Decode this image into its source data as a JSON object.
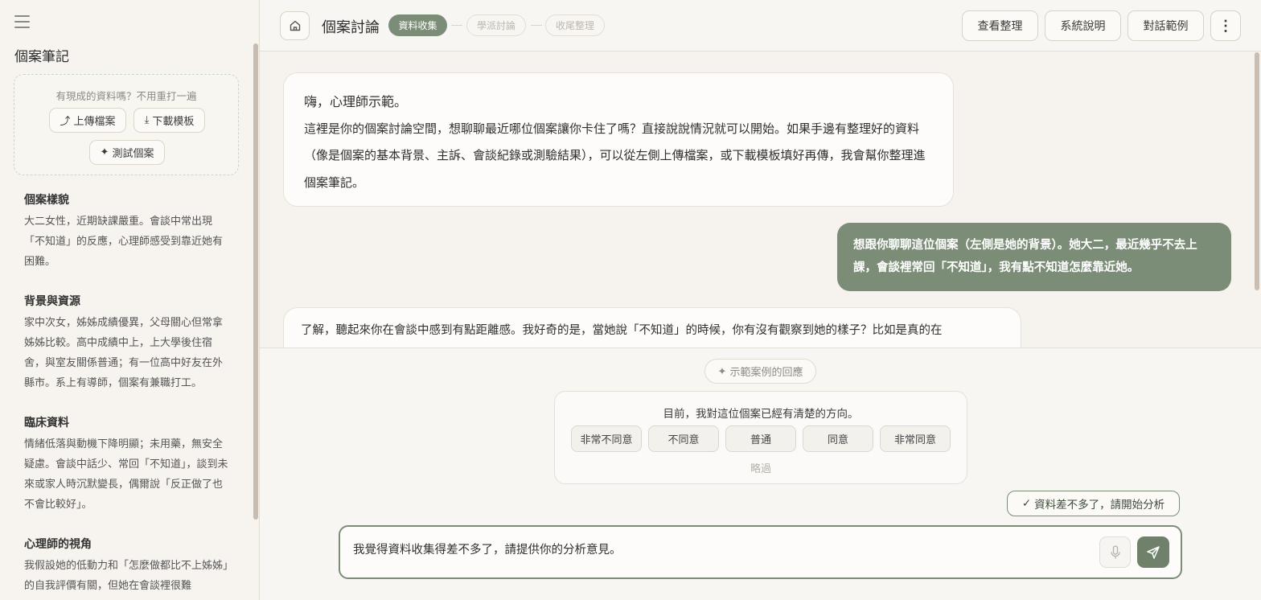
{
  "sidebar": {
    "title": "個案筆記",
    "upload_hint": "有現成的資料嗎？不用重打一遍",
    "upload_label": "上傳檔案",
    "upload_icon": "⤴",
    "template_label": "下載模板",
    "template_icon": "⤓",
    "test_label": "測試個案",
    "test_icon": "✦",
    "sections": [
      {
        "heading": "個案樣貌",
        "body": "大二女性，近期缺課嚴重。會談中常出現「不知道」的反應，心理師感受到靠近她有困難。"
      },
      {
        "heading": "背景與資源",
        "body": "家中次女，姊姊成績優異，父母關心但常拿姊姊比較。高中成績中上，上大學後住宿舍，與室友關係普通；有一位高中好友在外縣市。系上有導師，個案有兼職打工。"
      },
      {
        "heading": "臨床資料",
        "body": "情緒低落與動機下降明顯；未用藥，無安全疑慮。會談中話少、常回「不知道」，談到未來或家人時沉默變長，偶爾說「反正做了也不會比較好」。"
      },
      {
        "heading": "心理師的視角",
        "body": "我假設她的低動力和「怎麼做都比不上姊姊」的自我評價有關，但她在會談裡很難"
      }
    ]
  },
  "header": {
    "title": "個案討論",
    "stages": [
      "資料收集",
      "學派討論",
      "收尾整理"
    ],
    "buttons": [
      "查看整理",
      "系統說明",
      "對話範例"
    ],
    "more_icon": "⋮"
  },
  "chat": {
    "ai_greeting_title": "嗨，心理師示範。",
    "ai_greeting_body": "這裡是你的個案討論空間，想聊聊最近哪位個案讓你卡住了嗎？直接說說情況就可以開始。如果手邊有整理好的資料（像是個案的基本背景、主訴、會談紀錄或測驗結果），可以從左側上傳檔案，或下載模板填好再傳，我會幫你整理進個案筆記。",
    "user_message": "想跟你聊聊這位個案（左側是她的背景）。她大二，最近幾乎不去上課，會談裡常回「不知道」，我有點不知道怎麼靠近她。",
    "ai_reply": "了解，聽起來你在會談中感到有點距離感。我好奇的是，當她說「不知道」的時候，你有沒有觀察到她的樣子？比如是真的在"
  },
  "bottom": {
    "example_label": "示範案例的回應",
    "example_icon": "✦",
    "survey_question": "目前，我對這位個案已經有清楚的方向。",
    "scale": [
      "非常不同意",
      "不同意",
      "普通",
      "同意",
      "非常同意"
    ],
    "skip": "略過",
    "analyze_label": "資料差不多了，請開始分析",
    "analyze_icon": "✓",
    "composer_text": "我覺得資料收集得差不多了，請提供你的分析意見。"
  },
  "colors": {
    "accent": "#7b8d77",
    "background": "#f6f3ee"
  }
}
